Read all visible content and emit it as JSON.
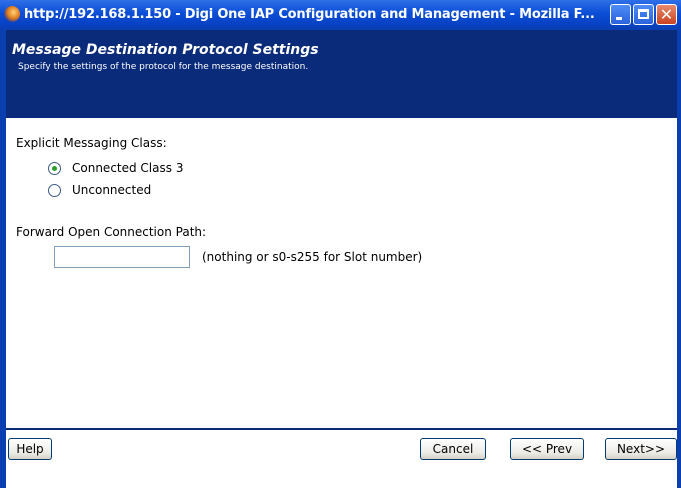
{
  "window": {
    "title": "http://192.168.1.150 - Digi One IAP Configuration and Management - Mozilla F...",
    "close_glyph": "✕"
  },
  "header": {
    "title": "Message Destination Protocol Settings",
    "subtitle": "Specify the settings of the protocol for the message destination."
  },
  "form": {
    "explicit_label": "Explicit Messaging Class:",
    "options": [
      {
        "label": "Connected Class 3",
        "selected": true
      },
      {
        "label": "Unconnected",
        "selected": false
      }
    ],
    "path_label": "Forward Open Connection Path:",
    "path_value": "",
    "path_hint": "(nothing or s0-s255 for Slot number)"
  },
  "buttons": {
    "help": "Help",
    "cancel": "Cancel",
    "prev": "<< Prev",
    "next": "Next>>"
  },
  "colors": {
    "header_bg": "#0a2a7a",
    "titlebar": "#0a4dd6"
  }
}
